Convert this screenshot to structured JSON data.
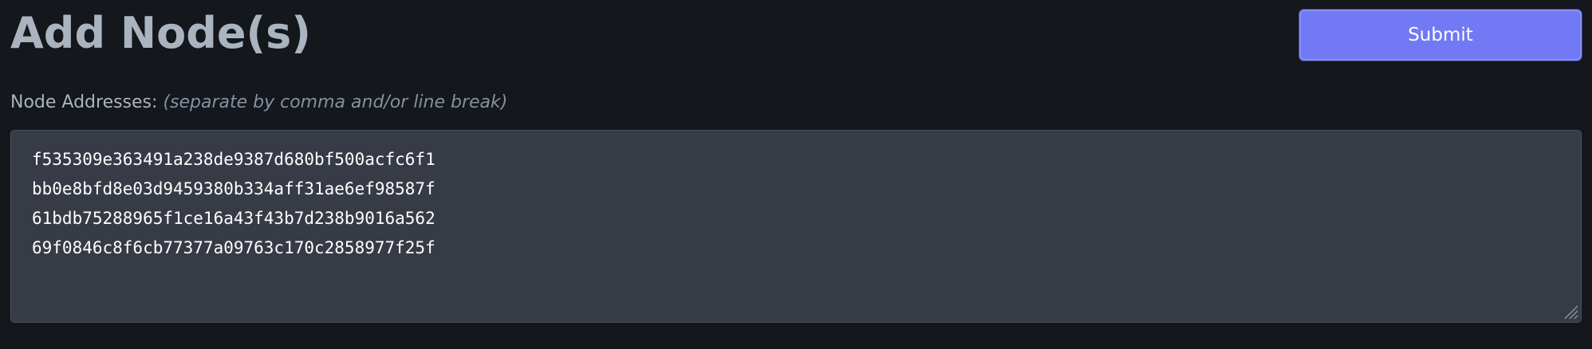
{
  "header": {
    "title": "Add Node(s)",
    "submit_label": "Submit"
  },
  "form": {
    "label": "Node Addresses:",
    "hint": "(separate by comma and/or line break)",
    "addresses": [
      "f535309e363491a238de9387d680bf500acfc6f1",
      "bb0e8bfd8e03d9459380b334aff31ae6ef98587f",
      "61bdb75288965f1ce16a43f43b7d238b9016a562",
      "69f0846c8f6cb77377a09763c170c2858977f25f"
    ]
  },
  "colors": {
    "background": "#14171b",
    "accent": "#7179f4",
    "textarea_bg": "#363b45",
    "title": "#aab4c0"
  },
  "icons": {
    "resize": "resize-handle-icon"
  }
}
